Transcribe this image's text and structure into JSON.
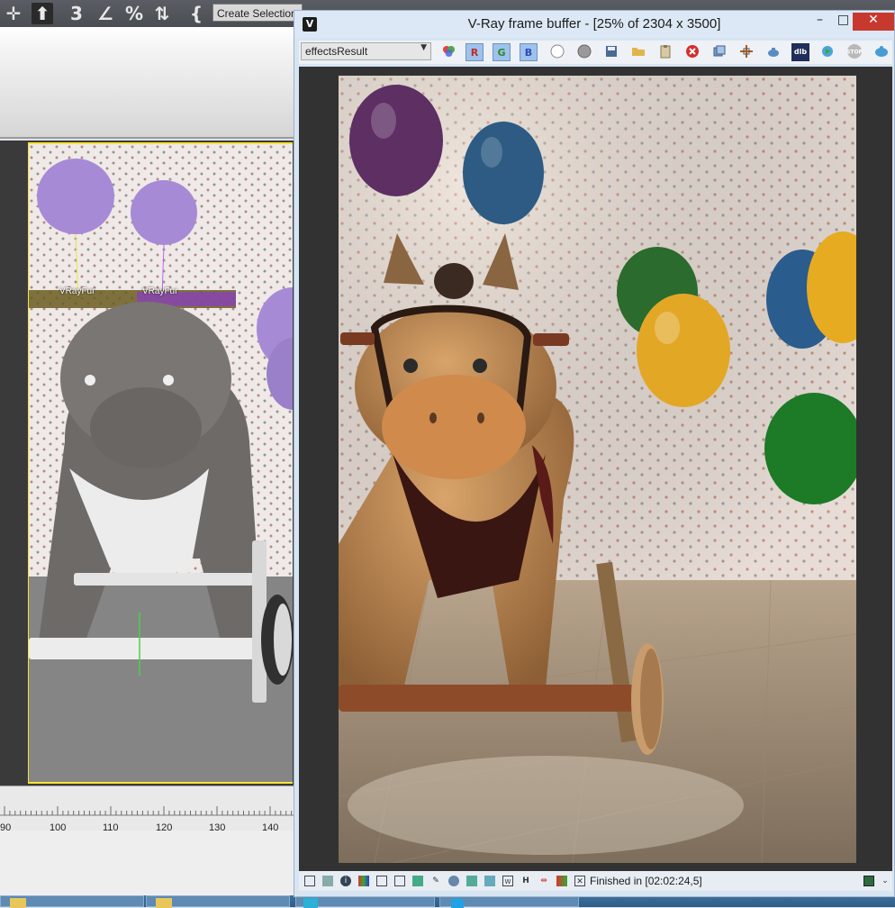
{
  "max": {
    "toolbar": {
      "create_selection_set": "Create Selection Se",
      "buttons": [
        {
          "icon": "move-icon",
          "glyph": "✛"
        },
        {
          "icon": "upload-icon",
          "glyph": "⬆"
        },
        {
          "icon": "snap-3d-icon",
          "glyph": "3"
        },
        {
          "icon": "angle-snap-icon",
          "glyph": "∠"
        },
        {
          "icon": "percent-snap-icon",
          "glyph": "%"
        },
        {
          "icon": "spinner-snap-icon",
          "glyph": "⇅"
        },
        {
          "icon": "edit-named-selections-icon",
          "glyph": "{"
        }
      ]
    },
    "viewport": {
      "fur_labels": [
        "VRayFur",
        "VRayFur"
      ]
    },
    "timeline": {
      "ticks": [
        "90",
        "100",
        "110",
        "120",
        "130",
        "140"
      ]
    }
  },
  "vfb": {
    "title": "V-Ray frame buffer - [25% of 2304 x 3500]",
    "window_controls": {
      "minimize": "–",
      "maximize": "□",
      "close": "✕"
    },
    "channel": "effectsResult",
    "toolbar_icons": [
      "color-picker-icon",
      "red-channel-icon",
      "green-channel-icon",
      "blue-channel-icon",
      "white-circle-icon",
      "gray-circle-icon",
      "save-icon",
      "open-folder-icon",
      "clipboard-icon",
      "clear-image-icon",
      "duplicate-icon",
      "region-render-icon",
      "teapot-render-icon",
      "lut-icon",
      "interactive-render-icon",
      "stop-icon",
      "render-icon"
    ],
    "rgb_labels": {
      "r": "R",
      "g": "G",
      "b": "B"
    },
    "status": "Finished in [02:02:24,5]",
    "colors": {
      "title_bg": "#dce8f5",
      "close": "#c7392f",
      "render_bg": "#323232"
    }
  }
}
